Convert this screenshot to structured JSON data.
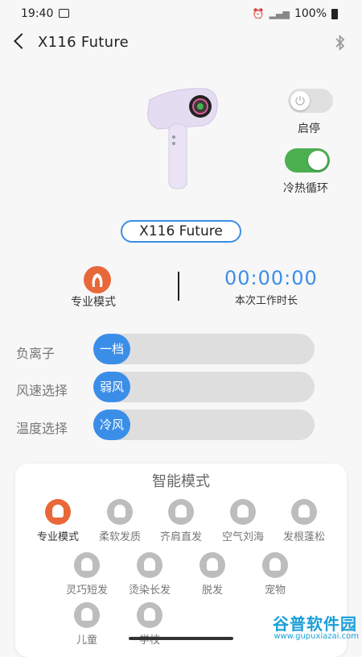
{
  "status": {
    "time": "19:40",
    "battery": "100%"
  },
  "header": {
    "title": "X116 Future"
  },
  "device": {
    "model_badge": "X116 Future",
    "power_label": "启停",
    "power_on": false,
    "cycle_label": "冷热循环",
    "cycle_on": true
  },
  "stats": {
    "mode_label": "专业模式",
    "timer": "00:00:00",
    "timer_label": "本次工作时长"
  },
  "sliders": [
    {
      "label": "负离子",
      "value": "一档"
    },
    {
      "label": "风速选择",
      "value": "弱风"
    },
    {
      "label": "温度选择",
      "value": "冷风"
    }
  ],
  "smart": {
    "title": "智能模式",
    "modes": [
      {
        "name": "专业模式",
        "icon": "hair-silhouette-icon",
        "active": true
      },
      {
        "name": "柔软发质",
        "icon": "hair-soft-icon"
      },
      {
        "name": "齐肩直发",
        "icon": "hair-straight-icon"
      },
      {
        "name": "空气刘海",
        "icon": "hair-bangs-icon"
      },
      {
        "name": "发根蓬松",
        "icon": "hair-root-icon"
      },
      {
        "name": "灵巧短发",
        "icon": "hair-short-icon"
      },
      {
        "name": "烫染长发",
        "icon": "hair-long-icon"
      },
      {
        "name": "脱发",
        "icon": "hair-loss-icon"
      },
      {
        "name": "宠物",
        "icon": "pet-icon"
      },
      {
        "name": "儿童",
        "icon": "child-icon"
      },
      {
        "name": "学校",
        "icon": "school-icon"
      }
    ]
  },
  "watermark": {
    "line1": "谷普软件园",
    "line2": "www.gupuxiazai.com"
  },
  "colors": {
    "accent": "#3b8ee8",
    "active_mode": "#e8683a",
    "toggle_on": "#4caf50"
  }
}
